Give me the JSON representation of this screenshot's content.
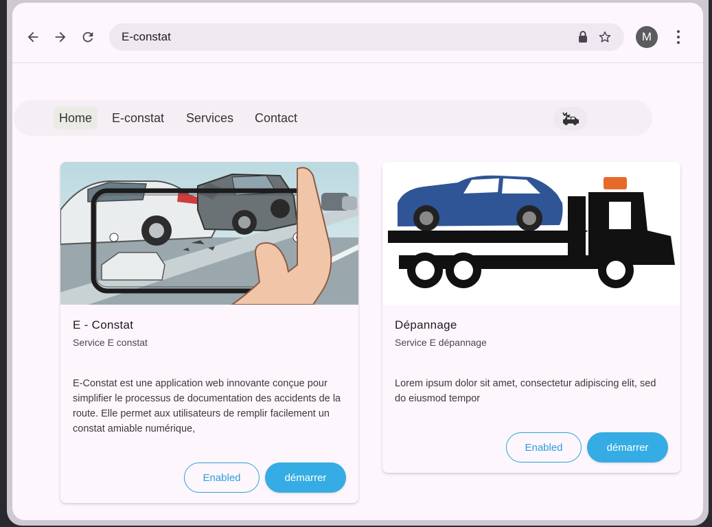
{
  "browser": {
    "address_text": "E-constat",
    "avatar_letter": "M",
    "back_icon": "arrow-left-icon",
    "forward_icon": "arrow-right-icon",
    "reload_icon": "reload-icon",
    "lock_icon": "lock-icon",
    "star_icon": "star-icon",
    "menu_icon": "kebab-menu-icon"
  },
  "nav": {
    "items": [
      {
        "label": "Home",
        "active": true
      },
      {
        "label": "E-constat",
        "active": false
      },
      {
        "label": "Services",
        "active": false
      },
      {
        "label": "Contact",
        "active": false
      }
    ],
    "logo_icon": "car-crash-icon"
  },
  "cards": [
    {
      "title": "E - Constat",
      "subtitle": "Service E constat",
      "body": "E-Constat est une application web innovante conçue pour simplifier le processus de documentation des accidents de la route. Elle permet aux utilisateurs de remplir facilement un constat amiable numérique,",
      "outlined_button": "Enabled",
      "filled_button": "démarrer",
      "image": "car-accident-phone-photo"
    },
    {
      "title": "Dépannage",
      "subtitle": "Service E dépannage",
      "body": "Lorem ipsum dolor sit amet, consectetur adipiscing elit, sed do eiusmod tempor",
      "outlined_button": "Enabled",
      "filled_button": "démarrer",
      "image": "tow-truck-with-car"
    }
  ],
  "colors": {
    "accent": "#35ace3",
    "background": "#fdf6fd",
    "truck_car": "#2f5596"
  }
}
